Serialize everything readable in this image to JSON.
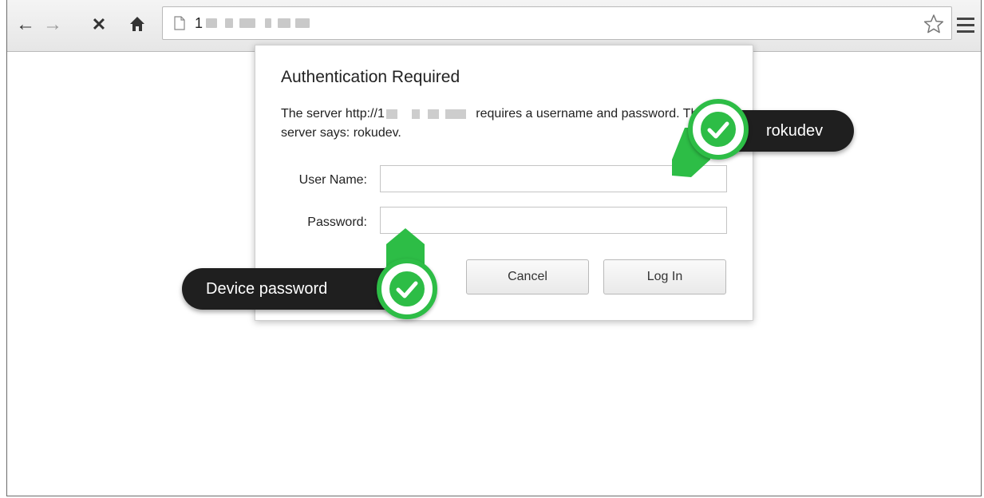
{
  "browser": {
    "url_text": "1",
    "nav": {
      "back": "←",
      "forward": "→",
      "stop": "✕",
      "home": "⌂"
    }
  },
  "dialog": {
    "title": "Authentication Required",
    "message_prefix": "The server http://1",
    "message_suffix": " requires a username and password. The server says: rokudev.",
    "username_label": "User Name:",
    "username_value": "",
    "password_label": "Password:",
    "password_value": "",
    "cancel_label": "Cancel",
    "login_label": "Log In"
  },
  "callouts": {
    "username_hint": "rokudev",
    "password_hint": "Device password"
  },
  "colors": {
    "accent_green": "#2dbd46",
    "callout_bg": "#1f1f1f"
  },
  "icons": [
    "back-icon",
    "forward-icon",
    "stop-icon",
    "home-icon",
    "page-icon",
    "star-icon",
    "menu-icon",
    "checkmark-icon"
  ]
}
